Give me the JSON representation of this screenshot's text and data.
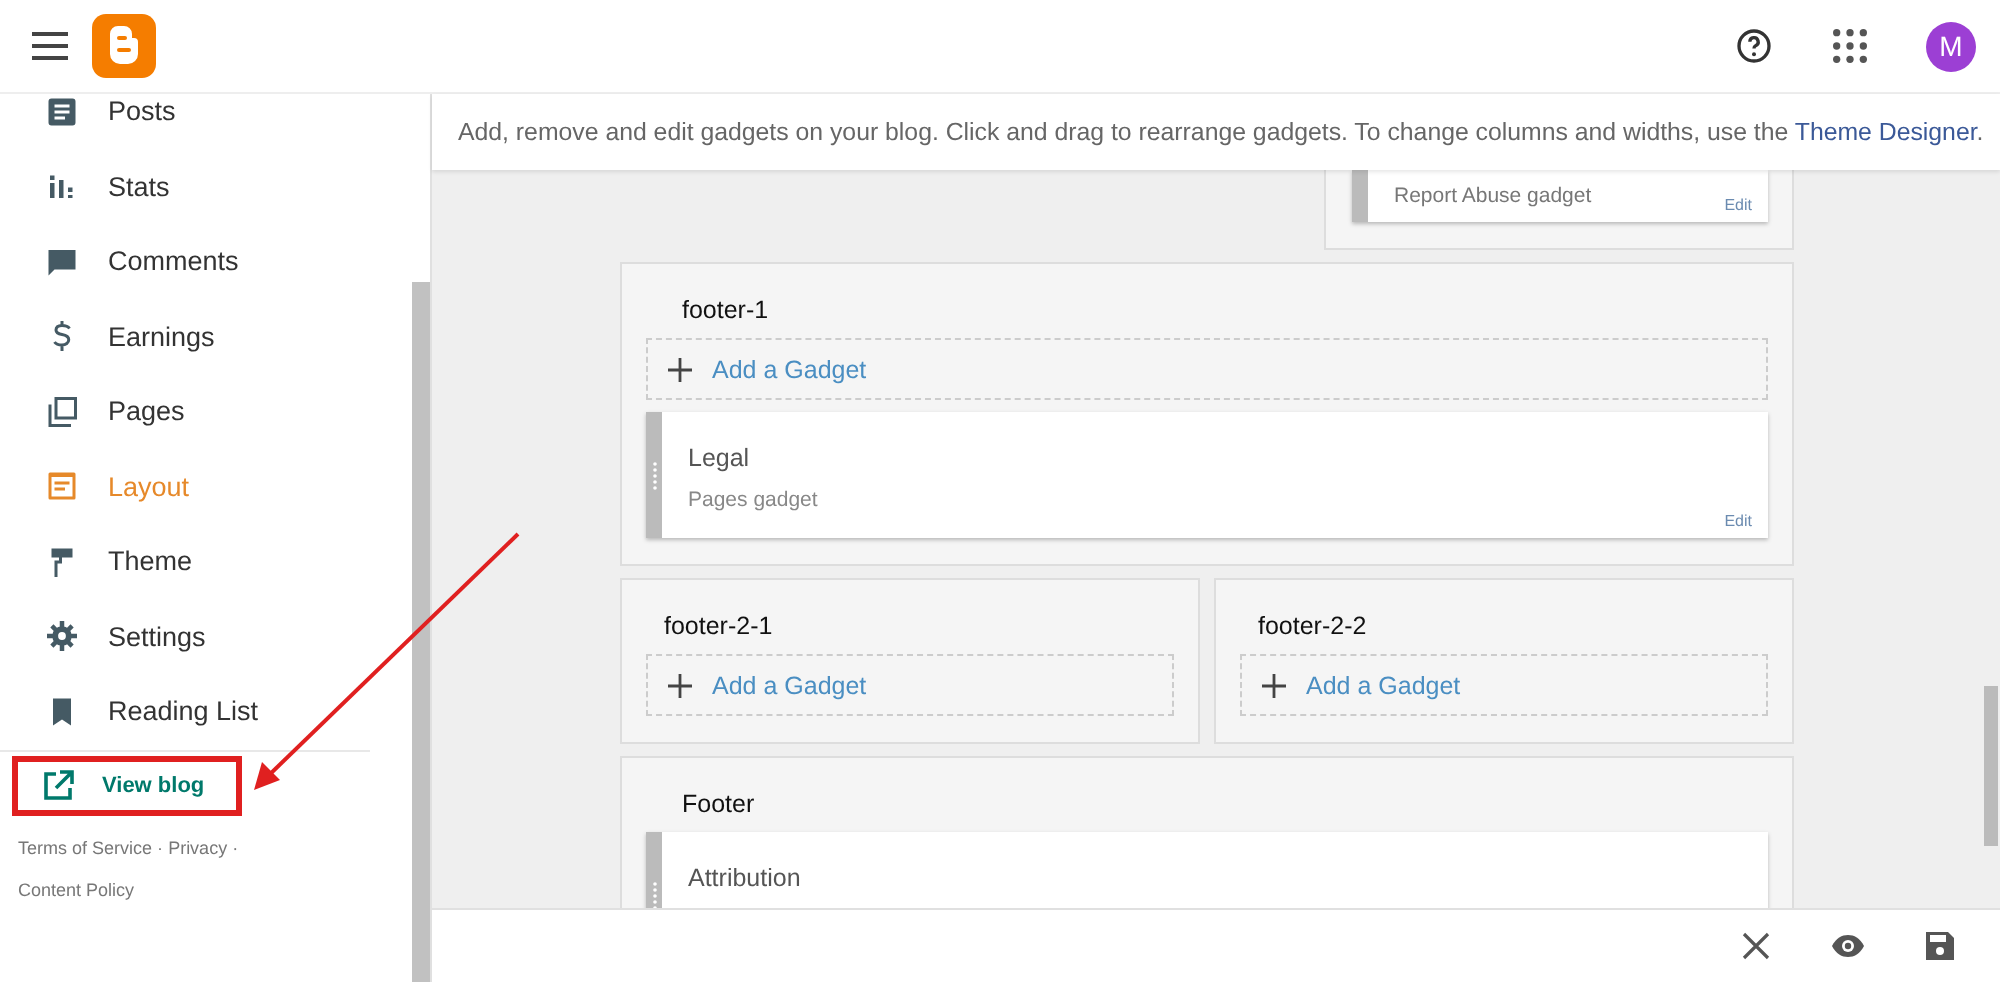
{
  "app_bar": {
    "avatar": "M"
  },
  "sidebar": {
    "items": [
      {
        "label": "Posts",
        "selected": false
      },
      {
        "label": "Stats",
        "selected": false
      },
      {
        "label": "Comments",
        "selected": false
      },
      {
        "label": "Earnings",
        "selected": false
      },
      {
        "label": "Pages",
        "selected": false
      },
      {
        "label": "Layout",
        "selected": true
      },
      {
        "label": "Theme",
        "selected": false
      },
      {
        "label": "Settings",
        "selected": false
      },
      {
        "label": "Reading List",
        "selected": false
      }
    ],
    "view_blog": "View blog",
    "footer_links": [
      {
        "label": "Terms of Service",
        "separator": "·"
      },
      {
        "label": "Privacy",
        "separator": "·"
      },
      {
        "label": "Content Policy"
      }
    ]
  },
  "info": {
    "text": "Add, remove and edit gadgets on your blog. Click and drag to rearrange gadgets. To change columns and widths, use the ",
    "link": "Theme Designer",
    "end": "."
  },
  "layout": {
    "partial_gadget": {
      "subtitle": "Report Abuse gadget",
      "edit": "Edit"
    },
    "rows": [
      [
        {
          "title": "footer-1",
          "add": "Add a Gadget",
          "gadgets": [
            {
              "title": "Legal",
              "subtitle": "Pages gadget",
              "edit": "Edit"
            }
          ]
        }
      ],
      [
        {
          "title": "footer-2-1",
          "add": "Add a Gadget"
        },
        {
          "title": "footer-2-2",
          "add": "Add a Gadget"
        }
      ],
      [
        {
          "title": "Footer",
          "gadgets": [
            {
              "title": "Attribution"
            }
          ]
        }
      ]
    ]
  }
}
